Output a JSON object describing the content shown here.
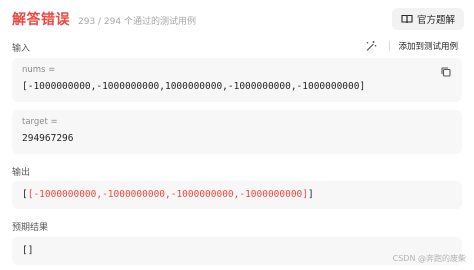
{
  "header": {
    "result": "解答错误",
    "passed": "293 / 294 个通过的测试用例",
    "solution_button": "官方题解"
  },
  "input": {
    "label": "输入",
    "add_testcase": "添加到测试用例",
    "nums_label": "nums =",
    "nums_value": "[-1000000000,-1000000000,1000000000,-1000000000,-1000000000]",
    "target_label": "target =",
    "target_value": "294967296"
  },
  "output": {
    "label": "输出",
    "open_bracket": "[",
    "value": "[-1000000000,-1000000000,-1000000000,-1000000000]",
    "close_bracket": "]"
  },
  "expected": {
    "label": "预期结果",
    "value": "[]"
  },
  "watermark": "CSDN @奔跑的废柴",
  "colors": {
    "error_red": "#ef4743",
    "card_bg": "#f7f7f8"
  },
  "icons": [
    "book-icon",
    "magic-wand-icon",
    "copy-icon"
  ]
}
